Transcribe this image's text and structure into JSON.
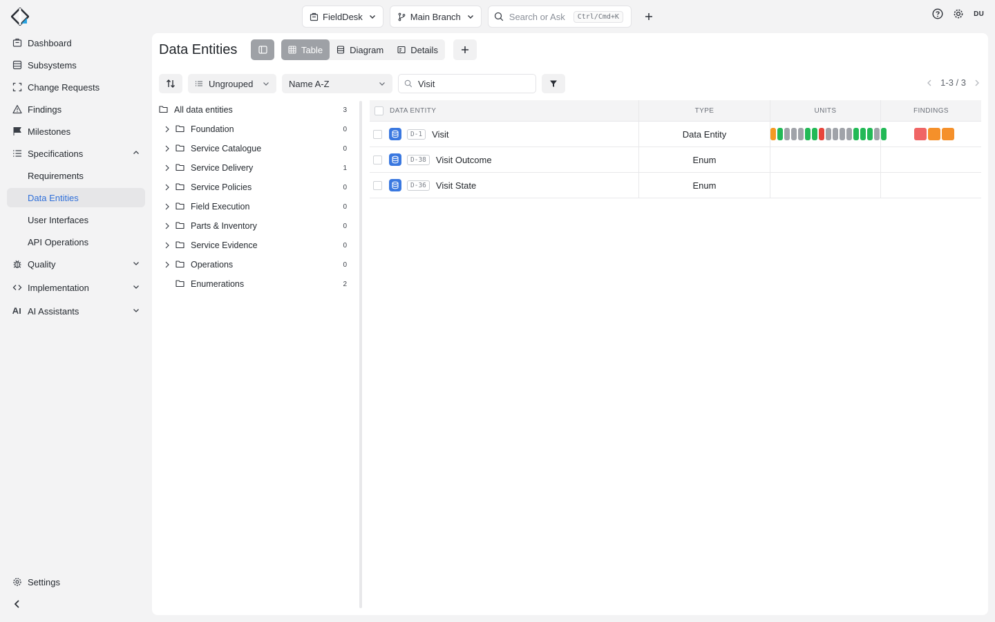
{
  "topbar": {
    "project": "FieldDesk",
    "branch": "Main Branch",
    "search_placeholder": "Search or Ask",
    "search_shortcut": "Ctrl/Cmd+K",
    "user_initials": "DU"
  },
  "sidebar": {
    "items": [
      {
        "label": "Dashboard",
        "icon": "dashboard-icon"
      },
      {
        "label": "Subsystems",
        "icon": "subsystems-icon"
      },
      {
        "label": "Change Requests",
        "icon": "change-requests-icon"
      },
      {
        "label": "Findings",
        "icon": "warning-icon"
      },
      {
        "label": "Milestones",
        "icon": "flag-icon"
      },
      {
        "label": "Specifications",
        "icon": "list-icon",
        "expanded": true
      },
      {
        "label": "Requirements"
      },
      {
        "label": "Data Entities",
        "active": true
      },
      {
        "label": "User Interfaces"
      },
      {
        "label": "API Operations"
      },
      {
        "label": "Quality",
        "icon": "bug-icon",
        "expanded": false
      },
      {
        "label": "Implementation",
        "icon": "code-icon",
        "expanded": false
      },
      {
        "label": "AI Assistants",
        "icon": "ai-icon",
        "expanded": false
      }
    ],
    "settings_label": "Settings"
  },
  "main": {
    "title": "Data Entities",
    "views": [
      "Table",
      "Diagram",
      "Details"
    ],
    "active_view": "Table",
    "grouping": "Ungrouped",
    "ordering": "Name A-Z",
    "filter_text": "Visit",
    "pager": "1-3 / 3"
  },
  "tree": {
    "root": {
      "label": "All data entities",
      "count": "3"
    },
    "folders": [
      {
        "label": "Foundation",
        "count": "0",
        "expandable": true
      },
      {
        "label": "Service Catalogue",
        "count": "0",
        "expandable": true
      },
      {
        "label": "Service Delivery",
        "count": "1",
        "expandable": true
      },
      {
        "label": "Service Policies",
        "count": "0",
        "expandable": true
      },
      {
        "label": "Field Execution",
        "count": "0",
        "expandable": true
      },
      {
        "label": "Parts & Inventory",
        "count": "0",
        "expandable": true
      },
      {
        "label": "Service Evidence",
        "count": "0",
        "expandable": true
      },
      {
        "label": "Operations",
        "count": "0",
        "expandable": true
      },
      {
        "label": "Enumerations",
        "count": "2",
        "expandable": false
      }
    ]
  },
  "table": {
    "columns": [
      "Data Entity",
      "Type",
      "Units",
      "Findings"
    ],
    "rows": [
      {
        "id": "D-1",
        "name": "Visit",
        "type": "Data Entity",
        "units": [
          "#f59a23",
          "#22b956",
          "#a0a3a9",
          "#a0a3a9",
          "#a0a3a9",
          "#22b956",
          "#22b956",
          "#e8453c",
          "#a0a3a9",
          "#a0a3a9",
          "#a0a3a9",
          "#a0a3a9",
          "#22b956",
          "#22b956",
          "#22b956",
          "#a0a3a9",
          "#22b956"
        ],
        "findings": [
          "#f06565",
          "#f5902a",
          "#f5902a"
        ]
      },
      {
        "id": "D-38",
        "name": "Visit Outcome",
        "type": "Enum",
        "units": [],
        "findings": []
      },
      {
        "id": "D-36",
        "name": "Visit State",
        "type": "Enum",
        "units": [],
        "findings": []
      }
    ]
  }
}
